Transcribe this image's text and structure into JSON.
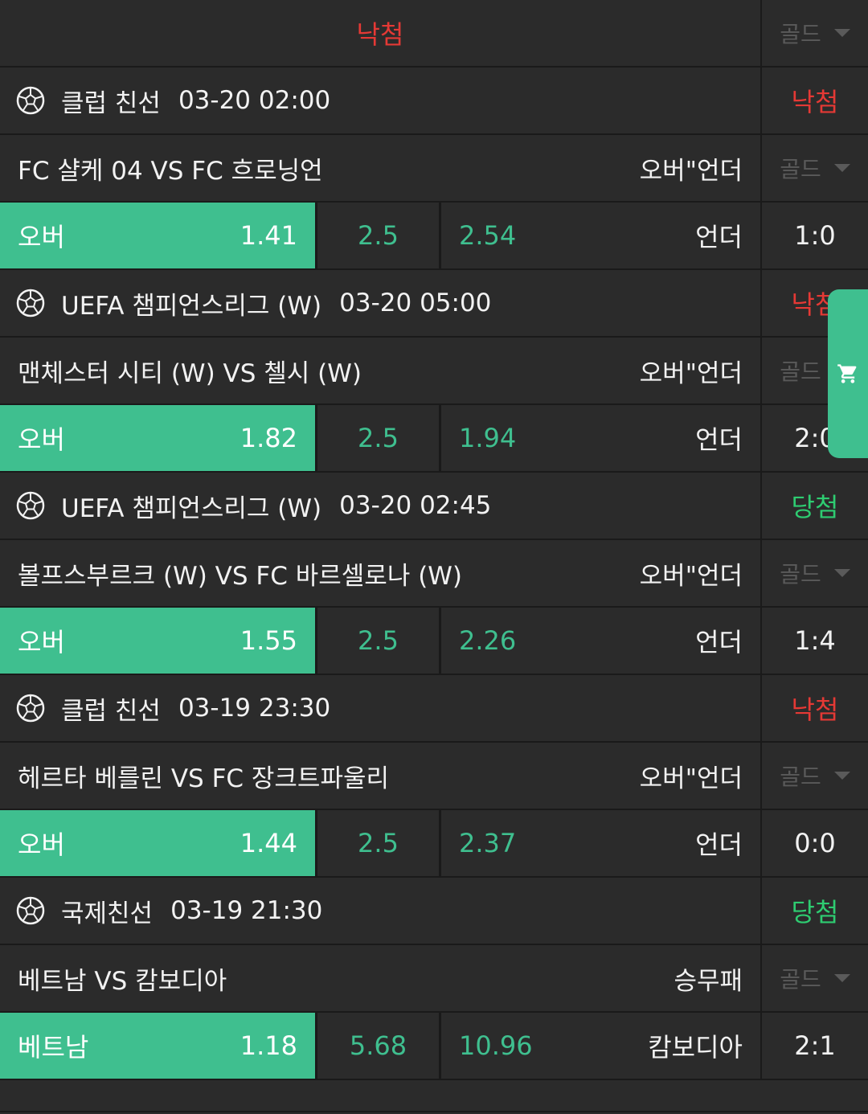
{
  "top": {
    "result": "낙첨",
    "gold": "골드"
  },
  "groups": [
    {
      "league": "클럽 친선",
      "date": "03-20 02:00",
      "result": "낙첨",
      "result_type": "lose",
      "match": "FC 샬케 04 VS FC 흐로닝언",
      "market": "오버\"언더",
      "gold": "골드",
      "a_label": "오버",
      "a_odd": "1.41",
      "b": "2.5",
      "c_odd": "2.54",
      "c_label": "언더",
      "score": "1:0"
    },
    {
      "league": "UEFA 챔피언스리그 (W)",
      "date": "03-20 05:00",
      "result": "낙첨",
      "result_type": "lose",
      "match": "맨체스터 시티 (W) VS 첼시 (W)",
      "market": "오버\"언더",
      "gold": "골드",
      "a_label": "오버",
      "a_odd": "1.82",
      "b": "2.5",
      "c_odd": "1.94",
      "c_label": "언더",
      "score": "2:0"
    },
    {
      "league": "UEFA 챔피언스리그 (W)",
      "date": "03-20 02:45",
      "result": "당첨",
      "result_type": "win",
      "match": "볼프스부르크 (W) VS FC 바르셀로나 (W)",
      "market": "오버\"언더",
      "gold": "골드",
      "a_label": "오버",
      "a_odd": "1.55",
      "b": "2.5",
      "c_odd": "2.26",
      "c_label": "언더",
      "score": "1:4"
    },
    {
      "league": "클럽 친선",
      "date": "03-19 23:30",
      "result": "낙첨",
      "result_type": "lose",
      "match": "헤르타 베를린 VS FC 장크트파울리",
      "market": "오버\"언더",
      "gold": "골드",
      "a_label": "오버",
      "a_odd": "1.44",
      "b": "2.5",
      "c_odd": "2.37",
      "c_label": "언더",
      "score": "0:0"
    },
    {
      "league": "국제친선",
      "date": "03-19 21:30",
      "result": "당첨",
      "result_type": "win",
      "match": "베트남 VS 캄보디아",
      "market": "승무패",
      "gold": "골드",
      "a_label": "베트남",
      "a_odd": "1.18",
      "b": "5.68",
      "c_odd": "10.96",
      "c_label": "캄보디아",
      "score": "2:1"
    }
  ],
  "colors": {
    "accent": "#3fbf8f",
    "lose": "#e53935",
    "win": "#2ecc71",
    "bg": "#2b2b2b"
  }
}
